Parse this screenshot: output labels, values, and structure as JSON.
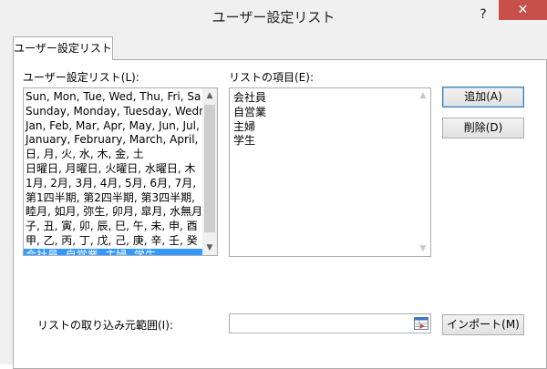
{
  "window": {
    "title": "ユーザー設定リスト",
    "help_label": "?",
    "close_label": "✕"
  },
  "tab": {
    "label": "ユーザー設定リスト"
  },
  "custom_lists": {
    "label": "ユーザー設定リスト(L):",
    "items": [
      "Sun, Mon, Tue, Wed, Thu, Fri, Sa",
      "Sunday, Monday, Tuesday, Wedn",
      "Jan, Feb, Mar, Apr, May, Jun, Jul,",
      "January, February, March, April, ",
      "日, 月, 火, 水, 木, 金, 土",
      "日曜日, 月曜日, 火曜日, 水曜日, 木",
      "1月, 2月, 3月, 4月, 5月, 6月, 7月, ",
      "第1四半期, 第2四半期, 第3四半期, ",
      "睦月, 如月, 弥生, 卯月, 皐月, 水無月",
      "子, 丑, 寅, 卯, 辰, 巳, 午, 未, 申, 酉",
      "甲, 乙, 丙, 丁, 戊, 己, 庚, 辛, 壬, 癸",
      "会社員, 自営業, 主婦, 学生"
    ],
    "selected_index": 11,
    "scroll_up_icon": "triangle-up",
    "scroll_down_icon": "triangle-down"
  },
  "list_entries": {
    "label": "リストの項目(E):",
    "lines": [
      "会社員",
      "自営業",
      "主婦",
      "学生"
    ]
  },
  "buttons": {
    "add": "追加(A)",
    "delete": "削除(D)",
    "import": "インポート(M)"
  },
  "import_range": {
    "label": "リストの取り込み元範囲(I):",
    "value": "",
    "collapse_icon": "range-select-icon"
  },
  "colors": {
    "selection": "#3399ff",
    "close_button": "#c7504b",
    "dialog_bg": "#f0f0f0"
  }
}
